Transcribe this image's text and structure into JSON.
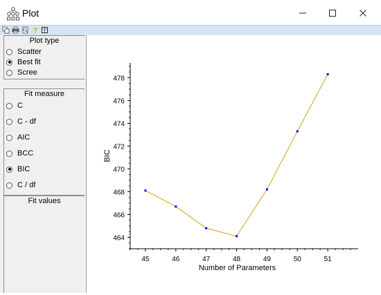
{
  "window": {
    "title": "Plot",
    "minimize_icon": "minimize-icon",
    "maximize_icon": "maximize-icon",
    "close_icon": "close-icon"
  },
  "toolbar": {
    "icons": [
      "copy-icon",
      "print-icon",
      "print-preview-icon",
      "help-icon",
      "book-icon"
    ]
  },
  "sidebar": {
    "plot_type": {
      "title": "Plot type",
      "options": [
        {
          "label": "Scatter",
          "selected": false
        },
        {
          "label": "Best fit",
          "selected": true
        },
        {
          "label": "Scree",
          "selected": false
        }
      ]
    },
    "fit_measure": {
      "title": "Fit measure",
      "options": [
        {
          "label": "C",
          "selected": false
        },
        {
          "label": "C - df",
          "selected": false
        },
        {
          "label": "AIC",
          "selected": false
        },
        {
          "label": "BCC",
          "selected": false
        },
        {
          "label": "BIC",
          "selected": true
        },
        {
          "label": "C / df",
          "selected": false
        }
      ]
    },
    "fit_values": {
      "title": "Fit values"
    }
  },
  "chart_data": {
    "type": "line",
    "x": [
      45,
      46,
      47,
      48,
      49,
      50,
      51
    ],
    "y": [
      468.1,
      466.7,
      464.8,
      464.1,
      468.2,
      473.3,
      478.3
    ],
    "xlabel": "Number of Parameters",
    "ylabel": "BIC",
    "xticks": [
      "45",
      "46",
      "47",
      "48",
      "49",
      "50",
      "51"
    ],
    "yticks": [
      "464",
      "466",
      "468",
      "470",
      "472",
      "474",
      "476",
      "478"
    ],
    "xlim": [
      44.5,
      52
    ],
    "ylim": [
      463,
      479.3
    ],
    "line_color": "#d4a017",
    "marker_color": "#0000ff",
    "grid": false
  }
}
